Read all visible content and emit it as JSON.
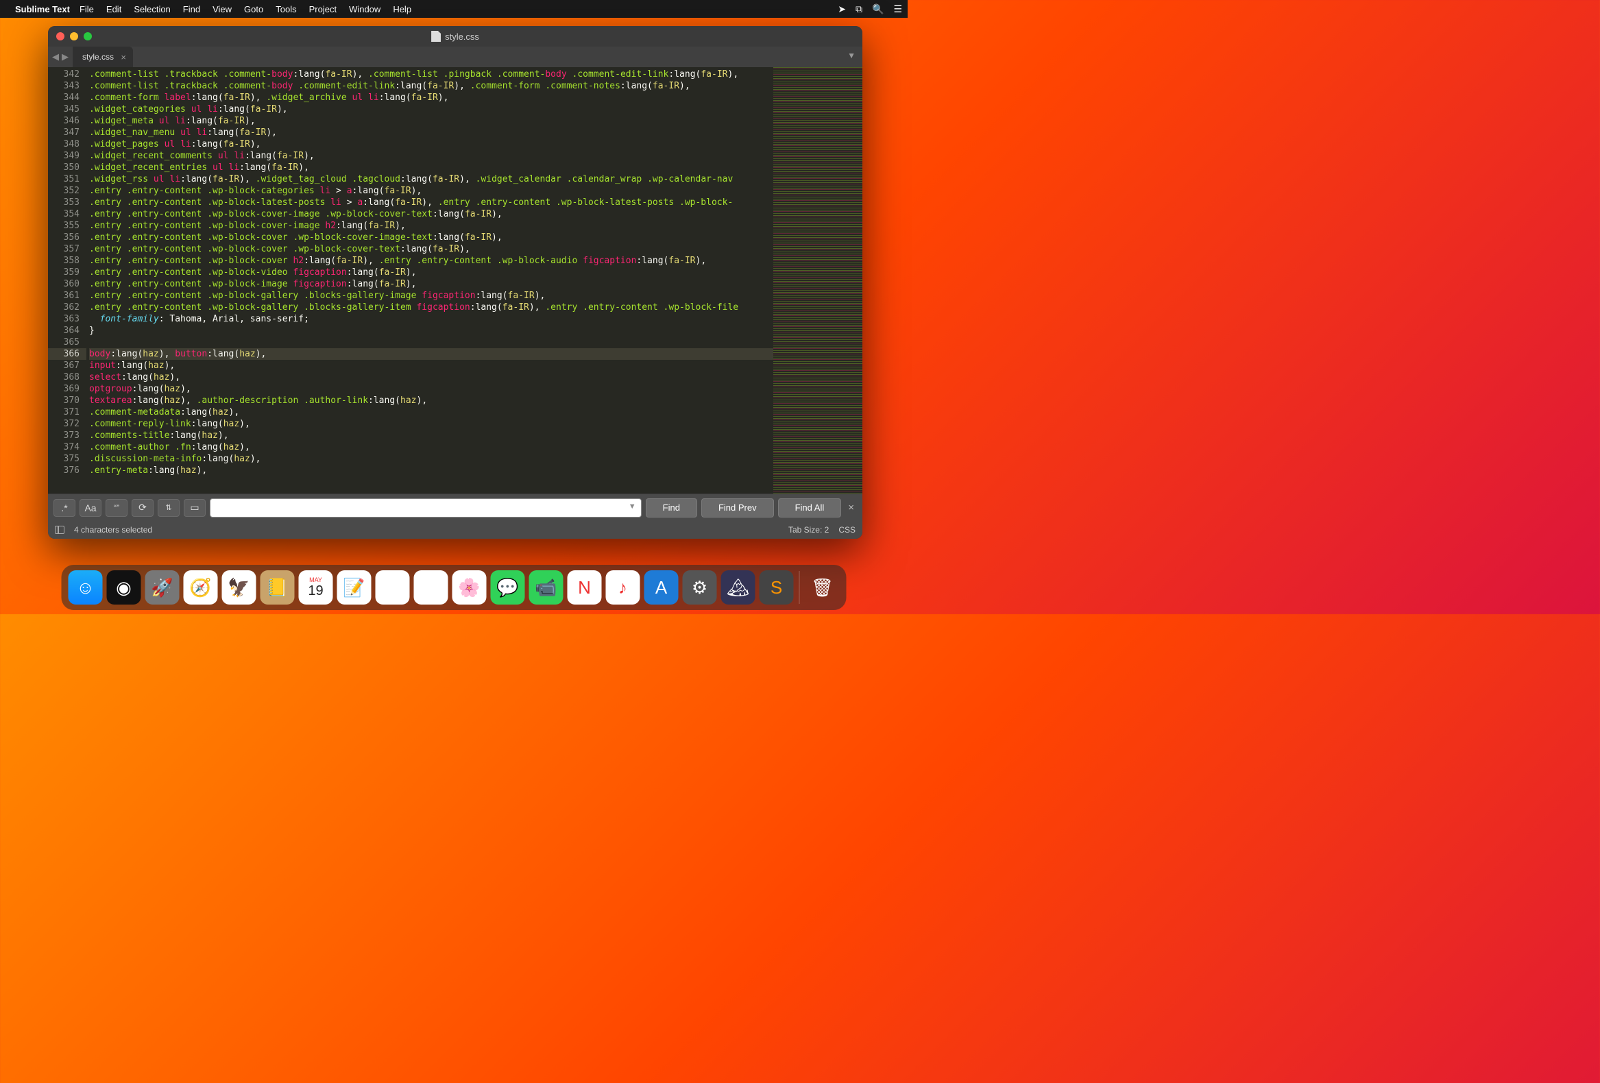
{
  "menubar": {
    "app": "Sublime Text",
    "items": [
      "File",
      "Edit",
      "Selection",
      "Find",
      "View",
      "Goto",
      "Tools",
      "Project",
      "Window",
      "Help"
    ]
  },
  "window": {
    "title": "style.css",
    "tab": "style.css"
  },
  "editor": {
    "first_line": 342,
    "highlighted_line": 366,
    "lines": [
      ".comment-list .trackback .comment-body:lang(fa-IR), .comment-list .pingback .comment-body .comment-edit-link:lang(fa-IR),",
      ".comment-list .trackback .comment-body .comment-edit-link:lang(fa-IR), .comment-form .comment-notes:lang(fa-IR),",
      ".comment-form label:lang(fa-IR), .widget_archive ul li:lang(fa-IR),",
      ".widget_categories ul li:lang(fa-IR),",
      ".widget_meta ul li:lang(fa-IR),",
      ".widget_nav_menu ul li:lang(fa-IR),",
      ".widget_pages ul li:lang(fa-IR),",
      ".widget_recent_comments ul li:lang(fa-IR),",
      ".widget_recent_entries ul li:lang(fa-IR),",
      ".widget_rss ul li:lang(fa-IR), .widget_tag_cloud .tagcloud:lang(fa-IR), .widget_calendar .calendar_wrap .wp-calendar-nav",
      ".entry .entry-content .wp-block-categories li > a:lang(fa-IR),",
      ".entry .entry-content .wp-block-latest-posts li > a:lang(fa-IR), .entry .entry-content .wp-block-latest-posts .wp-block-",
      ".entry .entry-content .wp-block-cover-image .wp-block-cover-text:lang(fa-IR),",
      ".entry .entry-content .wp-block-cover-image h2:lang(fa-IR),",
      ".entry .entry-content .wp-block-cover .wp-block-cover-image-text:lang(fa-IR),",
      ".entry .entry-content .wp-block-cover .wp-block-cover-text:lang(fa-IR),",
      ".entry .entry-content .wp-block-cover h2:lang(fa-IR), .entry .entry-content .wp-block-audio figcaption:lang(fa-IR),",
      ".entry .entry-content .wp-block-video figcaption:lang(fa-IR),",
      ".entry .entry-content .wp-block-image figcaption:lang(fa-IR),",
      ".entry .entry-content .wp-block-gallery .blocks-gallery-image figcaption:lang(fa-IR),",
      ".entry .entry-content .wp-block-gallery .blocks-gallery-item figcaption:lang(fa-IR), .entry .entry-content .wp-block-file",
      "  font-family: Tahoma, Arial, sans-serif;",
      "}",
      "",
      "body:lang(haz), button:lang(haz),",
      "input:lang(haz),",
      "select:lang(haz),",
      "optgroup:lang(haz),",
      "textarea:lang(haz), .author-description .author-link:lang(haz),",
      ".comment-metadata:lang(haz),",
      ".comment-reply-link:lang(haz),",
      ".comments-title:lang(haz),",
      ".comment-author .fn:lang(haz),",
      ".discussion-meta-info:lang(haz),",
      ".entry-meta:lang(haz),"
    ]
  },
  "find": {
    "value": "",
    "find_btn": "Find",
    "prev_btn": "Find Prev",
    "all_btn": "Find All"
  },
  "status": {
    "selection": "4 characters selected",
    "tabsize": "Tab Size: 2",
    "syntax": "CSS"
  },
  "dock": {
    "date_month": "MAY",
    "date_day": "19"
  }
}
